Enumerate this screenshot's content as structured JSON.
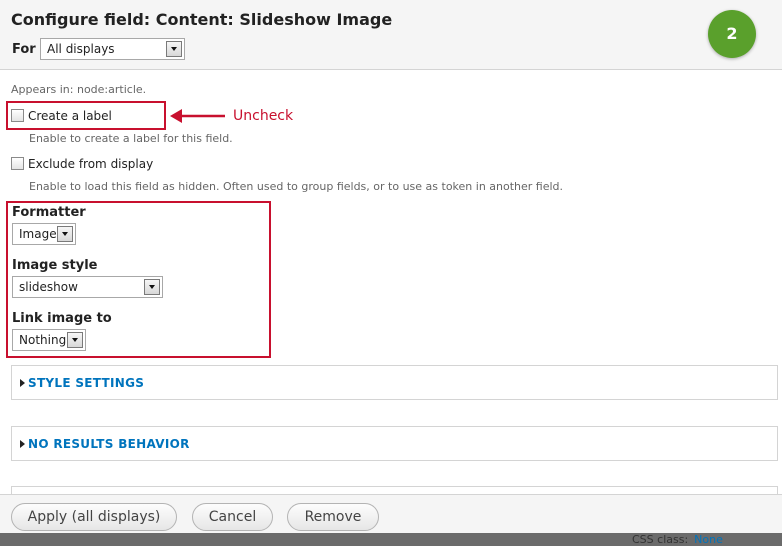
{
  "header": {
    "title": "Configure field: Content: Slideshow Image",
    "for_label": "For",
    "for_select_value": "All displays",
    "step_number": "2"
  },
  "form": {
    "appears_in": "Appears in: node:article.",
    "create_label": {
      "label": "Create a label",
      "checked": false,
      "description": "Enable to create a label for this field."
    },
    "exclude": {
      "label": "Exclude from display",
      "checked": false,
      "description": "Enable to load this field as hidden. Often used to group fields, or to use as token in another field."
    },
    "formatter": {
      "label": "Formatter",
      "value": "Image"
    },
    "image_style": {
      "label": "Image style",
      "value": "slideshow"
    },
    "link_image": {
      "label": "Link image to",
      "value": "Nothing"
    }
  },
  "annotation": {
    "text": "Uncheck",
    "color": "#c8102e"
  },
  "fieldsets": {
    "style_settings": "STYLE SETTINGS",
    "no_results": "NO RESULTS BEHAVIOR"
  },
  "footer": {
    "apply_label": "Apply (all displays)",
    "cancel_label": "Cancel",
    "remove_label": "Remove",
    "css_class_label": "CSS class:",
    "css_class_value": "None"
  },
  "colors": {
    "accent": "#0074bd",
    "step_badge": "#5aa02c",
    "annotation": "#c8102e"
  }
}
